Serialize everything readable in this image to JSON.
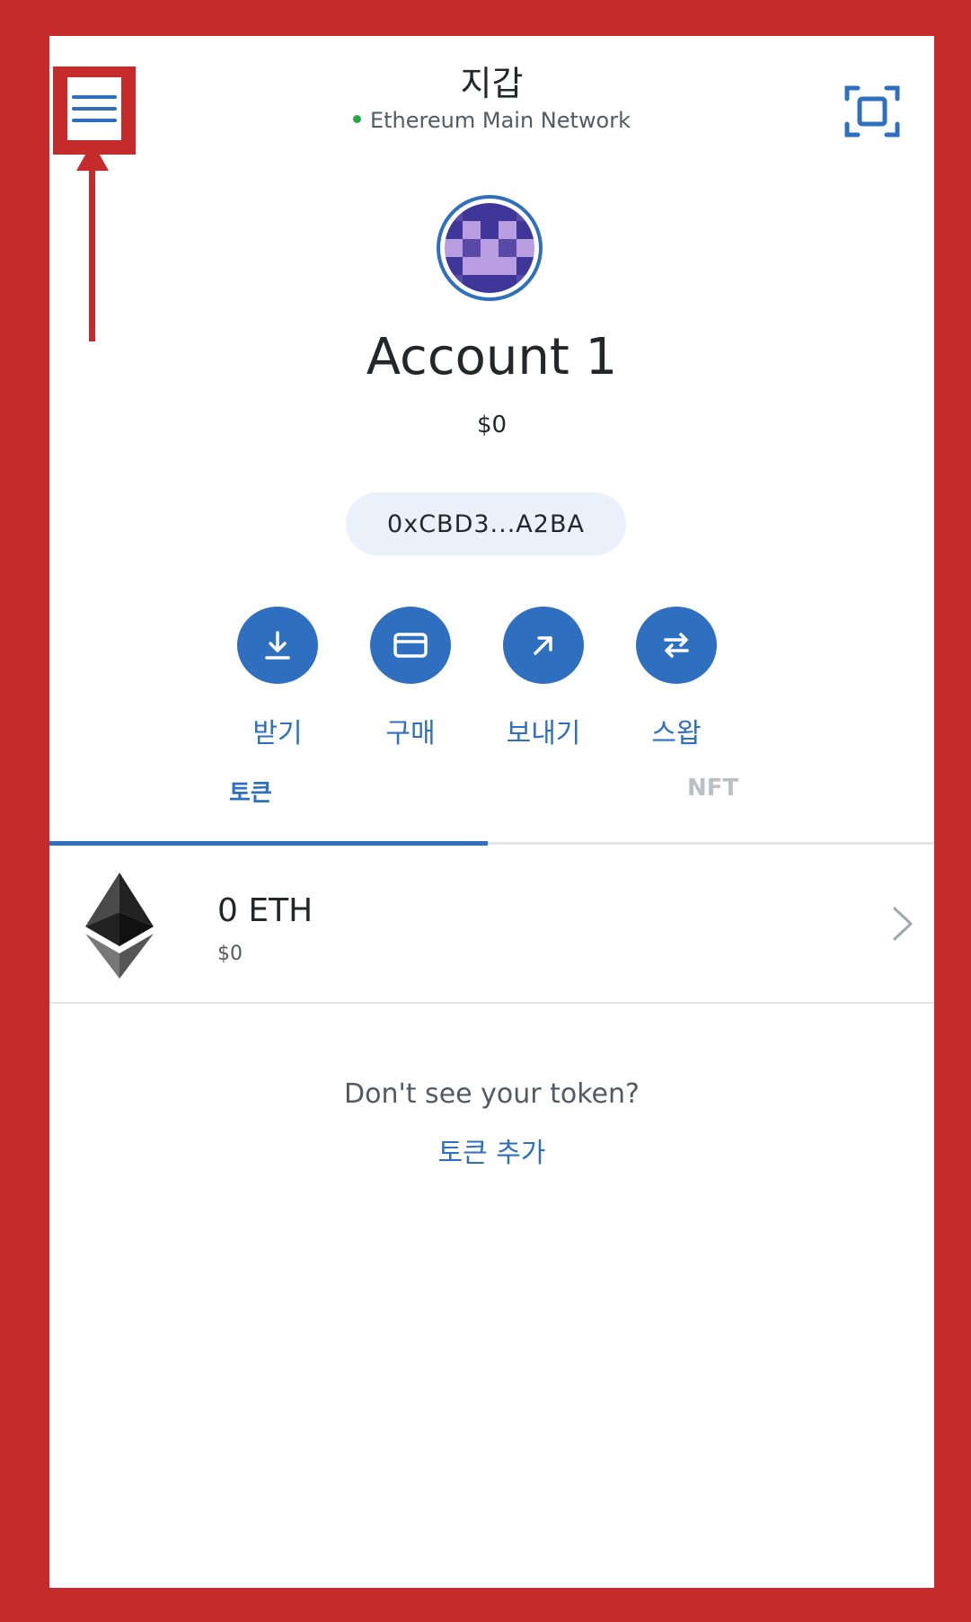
{
  "header": {
    "title": "지갑",
    "network": "Ethereum Main Network",
    "network_status_color": "#28a745"
  },
  "account": {
    "name": "Account 1",
    "balance": "$0",
    "address": "0xCBD3...A2BA"
  },
  "actions": [
    {
      "label": "받기",
      "icon": "download-icon"
    },
    {
      "label": "구매",
      "icon": "card-icon"
    },
    {
      "label": "보내기",
      "icon": "arrow-up-right-icon"
    },
    {
      "label": "스왑",
      "icon": "swap-icon"
    }
  ],
  "tabs": [
    {
      "label": "토큰",
      "active": true
    },
    {
      "label": "NFT",
      "active": false
    }
  ],
  "tokens": [
    {
      "amount": "0 ETH",
      "fiat": "$0",
      "icon": "ethereum-icon"
    }
  ],
  "footer": {
    "hint": "Don't see your token?",
    "add_token": "토큰 추가"
  },
  "colors": {
    "accent": "#2f6fbf",
    "annotation": "#c62b2b"
  }
}
